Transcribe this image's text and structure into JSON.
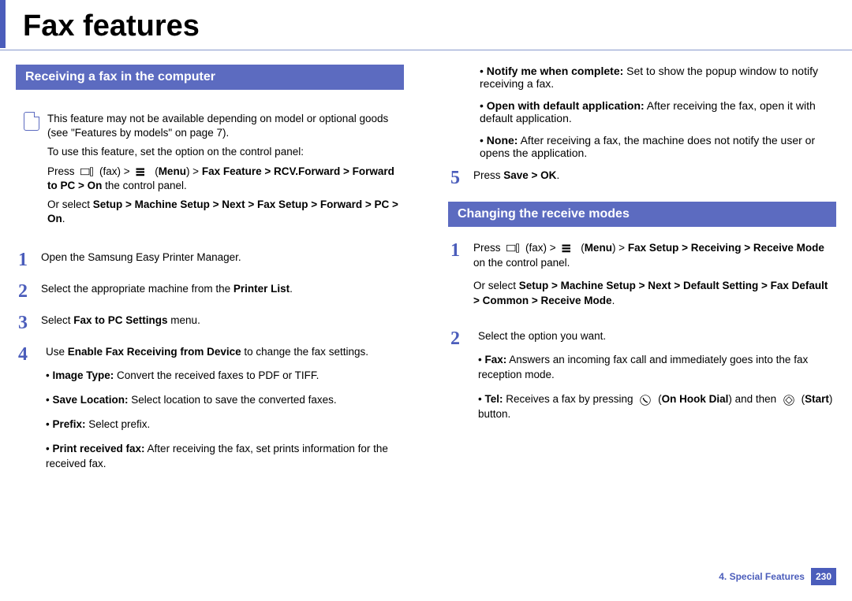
{
  "title": "Fax features",
  "left": {
    "heading": "Receiving a fax in the computer",
    "note1": "This feature may not be available depending on model or optional goods (see \"Features by models\" on page 7).",
    "note2": "To use this feature, set the option on the control panel:",
    "note3a": "Press ",
    "note3b": " (fax) > ",
    "note3c": " (",
    "menu": "Menu",
    "note3d": ") > ",
    "path1": "Fax Feature > RCV.Forward > Forward to PC > On",
    "note3e": " the control panel.",
    "note4a": "Or select ",
    "path2": "Setup > Machine Setup > Next > Fax Setup > Forward > PC > On",
    "note4b": ".",
    "steps": [
      {
        "num": "1",
        "text": "Open the Samsung Easy Printer Manager."
      },
      {
        "num": "2",
        "pre": "Select the appropriate machine from the ",
        "bold": "Printer List",
        "post": "."
      },
      {
        "num": "3",
        "pre": "Select ",
        "bold": "Fax to PC Settings",
        "post": " menu."
      }
    ],
    "step4": {
      "num": "4",
      "pre": "Use ",
      "bold": "Enable Fax Receiving from Device",
      "post": " to change the fax settings.",
      "bullets": [
        {
          "label": "Image Type:",
          "text": " Convert the received faxes to PDF or TIFF."
        },
        {
          "label": "Save Location:",
          "text": " Select location to save the converted faxes."
        },
        {
          "label": "Prefix:",
          "text": " Select prefix."
        },
        {
          "label": "Print received fax:",
          "text": " After receiving the fax, set prints information for the received fax."
        }
      ]
    }
  },
  "right": {
    "topbullets": [
      {
        "label": "Notify me when complete:",
        "text": " Set to show the popup window to notify receiving a fax."
      },
      {
        "label": "Open with default application:",
        "text": " After receiving the fax, open it with default application."
      },
      {
        "label": "None:",
        "text": " After receiving a fax, the machine does not notify the user or opens the application."
      }
    ],
    "step5": {
      "num": "5",
      "pre": "Press ",
      "bold": "Save > OK",
      "post": "."
    },
    "heading": "Changing the receive modes",
    "r1": {
      "num": "1",
      "a": "Press ",
      "b": " (fax) > ",
      "c": " (",
      "menu": "Menu",
      "d": ") > ",
      "path": "Fax Setup > Receiving > Receive Mode",
      "e": " on the control panel.",
      "f": "Or select ",
      "path2": "Setup > Machine Setup > Next > Default Setting > Fax Default > Common > Receive Mode",
      "g": "."
    },
    "r2": {
      "num": "2",
      "text": "Select the option you want.",
      "b1label": "Fax:",
      "b1text": " Answers an incoming fax call and immediately goes into the fax reception mode.",
      "b2label": "Tel:",
      "b2a": " Receives a fax by pressing ",
      "hook": "On Hook Dial",
      "b2b": ") and then ",
      "start": "Start",
      "b2c": ") button."
    }
  },
  "footer": {
    "chapter": "4.  Special Features",
    "page": "230"
  }
}
